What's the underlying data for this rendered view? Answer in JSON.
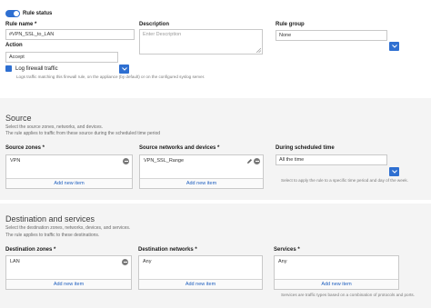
{
  "rule_status": {
    "label": "Rule status",
    "enabled": true
  },
  "rule_name": {
    "label": "Rule name *",
    "value": "#VPN_SSL_to_LAN"
  },
  "description": {
    "label": "Description",
    "placeholder": "Enter Description"
  },
  "rule_group": {
    "label": "Rule group",
    "value": "None"
  },
  "action": {
    "label": "Action",
    "value": "Accept"
  },
  "log_traffic": {
    "label": "Log firewall traffic",
    "checked": true,
    "help": "Logs traffic matching this firewall rule, on the appliance (by default) or on the configured syslog server."
  },
  "source": {
    "title": "Source",
    "subtitle_1": "Select the source zones, networks, and devices.",
    "subtitle_2": "The rule applies to traffic from these source during the scheduled time period",
    "zones": {
      "label": "Source zones *",
      "items": [
        "VPN"
      ],
      "add_label": "Add new item"
    },
    "networks": {
      "label": "Source networks and devices *",
      "items": [
        "VPN_SSL_Range"
      ],
      "add_label": "Add new item"
    },
    "schedule": {
      "label": "During scheduled time",
      "value": "All the time",
      "help": "Select to apply the rule to a specific time period and day of the week."
    }
  },
  "destination": {
    "title": "Destination and services",
    "subtitle_1": "Select the destination zones, networks, devices, and services.",
    "subtitle_2": "The rule applies to traffic to these destinations.",
    "zones": {
      "label": "Destination zones *",
      "items": [
        "LAN"
      ],
      "add_label": "Add new item"
    },
    "networks": {
      "label": "Destination networks *",
      "items": [
        "Any"
      ],
      "add_label": "Add new item"
    },
    "services": {
      "label": "Services *",
      "items": [
        "Any"
      ],
      "add_label": "Add new item",
      "help": "Services are traffic types based on a combination of protocols and ports."
    }
  },
  "colors": {
    "accent": "#2e6fd1",
    "link": "#1f5fbf",
    "band": "#f4f4f4"
  }
}
